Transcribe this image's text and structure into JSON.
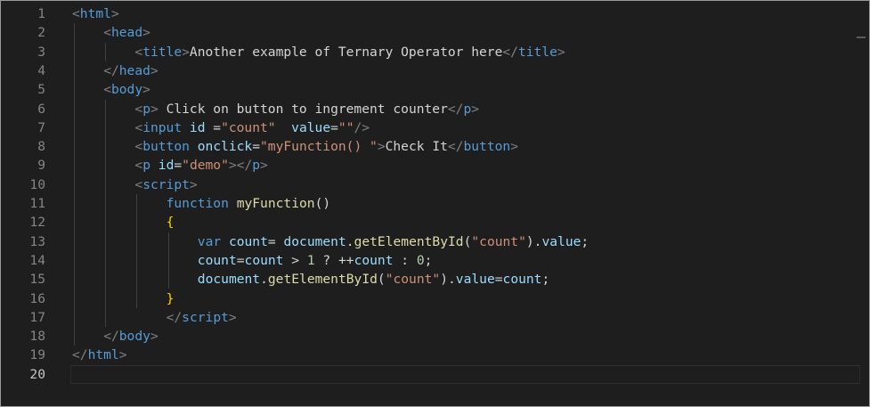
{
  "editor": {
    "line_numbers": [
      "1",
      "2",
      "3",
      "4",
      "5",
      "6",
      "7",
      "8",
      "9",
      "10",
      "11",
      "12",
      "13",
      "14",
      "15",
      "16",
      "17",
      "18",
      "19",
      "20"
    ],
    "current_line": 20,
    "colors": {
      "background": "#1e1e1e",
      "tag": "#569cd6",
      "bracket": "#808080",
      "attribute": "#9cdcfe",
      "string": "#ce9178",
      "function": "#dcdcaa",
      "brace": "#ffd700",
      "number": "#b5cea8",
      "text": "#d4d4d4"
    },
    "lines": [
      [
        [
          "<",
          "punc"
        ],
        [
          "html",
          "tag"
        ],
        [
          ">",
          "punc"
        ]
      ],
      [
        [
          "<",
          "punc"
        ],
        [
          "head",
          "tag"
        ],
        [
          ">",
          "punc"
        ]
      ],
      [
        [
          "<",
          "punc"
        ],
        [
          "title",
          "tag"
        ],
        [
          ">",
          "punc"
        ],
        [
          "Another example of Ternary Operator here",
          "text"
        ],
        [
          "</",
          "punc"
        ],
        [
          "title",
          "tag"
        ],
        [
          ">",
          "punc"
        ]
      ],
      [
        [
          "</",
          "punc"
        ],
        [
          "head",
          "tag"
        ],
        [
          ">",
          "punc"
        ]
      ],
      [
        [
          "<",
          "punc"
        ],
        [
          "body",
          "tag"
        ],
        [
          ">",
          "punc"
        ]
      ],
      [
        [
          "<",
          "punc"
        ],
        [
          "p",
          "tag"
        ],
        [
          ">",
          "punc"
        ],
        [
          " Click on button to ingrement counter",
          "text"
        ],
        [
          "</",
          "punc"
        ],
        [
          "p",
          "tag"
        ],
        [
          ">",
          "punc"
        ]
      ],
      [
        [
          "<",
          "punc"
        ],
        [
          "input",
          "tag"
        ],
        [
          " ",
          "text"
        ],
        [
          "id",
          "attr"
        ],
        [
          " =",
          "text"
        ],
        [
          "\"count\"",
          "str"
        ],
        [
          "  ",
          "text"
        ],
        [
          "value",
          "attr"
        ],
        [
          "=",
          "text"
        ],
        [
          "\"\"",
          "str"
        ],
        [
          "/>",
          "punc"
        ]
      ],
      [
        [
          "<",
          "punc"
        ],
        [
          "button",
          "tag"
        ],
        [
          " ",
          "text"
        ],
        [
          "onclick",
          "attr"
        ],
        [
          "=",
          "text"
        ],
        [
          "\"myFunction() \"",
          "str"
        ],
        [
          ">",
          "punc"
        ],
        [
          "Check It",
          "text"
        ],
        [
          "</",
          "punc"
        ],
        [
          "button",
          "tag"
        ],
        [
          ">",
          "punc"
        ]
      ],
      [
        [
          "<",
          "punc"
        ],
        [
          "p",
          "tag"
        ],
        [
          " ",
          "text"
        ],
        [
          "id",
          "attr"
        ],
        [
          "=",
          "text"
        ],
        [
          "\"demo\"",
          "str"
        ],
        [
          "></",
          "punc"
        ],
        [
          "p",
          "tag"
        ],
        [
          ">",
          "punc"
        ]
      ],
      [
        [
          "<",
          "punc"
        ],
        [
          "script",
          "tag"
        ],
        [
          ">",
          "punc"
        ]
      ],
      [
        [
          "function",
          "kw"
        ],
        [
          " ",
          "text"
        ],
        [
          "myFunction",
          "fn"
        ],
        [
          "()",
          "text"
        ]
      ],
      [
        [
          "{",
          "brace"
        ]
      ],
      [
        [
          "var",
          "kw"
        ],
        [
          " ",
          "text"
        ],
        [
          "count",
          "var"
        ],
        [
          "= ",
          "text"
        ],
        [
          "document",
          "var"
        ],
        [
          ".",
          "text"
        ],
        [
          "getElementById",
          "fn"
        ],
        [
          "(",
          "text"
        ],
        [
          "\"count\"",
          "str"
        ],
        [
          ").",
          "text"
        ],
        [
          "value",
          "var"
        ],
        [
          ";",
          "text"
        ]
      ],
      [
        [
          "count",
          "var"
        ],
        [
          "=",
          "text"
        ],
        [
          "count",
          "var"
        ],
        [
          " > ",
          "text"
        ],
        [
          "1",
          "num"
        ],
        [
          " ? ++",
          "text"
        ],
        [
          "count",
          "var"
        ],
        [
          " : ",
          "text"
        ],
        [
          "0",
          "num"
        ],
        [
          ";",
          "text"
        ]
      ],
      [
        [
          "document",
          "var"
        ],
        [
          ".",
          "text"
        ],
        [
          "getElementById",
          "fn"
        ],
        [
          "(",
          "text"
        ],
        [
          "\"count\"",
          "str"
        ],
        [
          ").",
          "text"
        ],
        [
          "value",
          "var"
        ],
        [
          "=",
          "text"
        ],
        [
          "count",
          "var"
        ],
        [
          ";",
          "text"
        ]
      ],
      [
        [
          "}",
          "brace"
        ]
      ],
      [
        [
          "</",
          "punc"
        ],
        [
          "script",
          "tag"
        ],
        [
          ">",
          "punc"
        ]
      ],
      [
        [
          "</",
          "punc"
        ],
        [
          "body",
          "tag"
        ],
        [
          ">",
          "punc"
        ]
      ],
      [
        [
          "</",
          "punc"
        ],
        [
          "html",
          "tag"
        ],
        [
          ">",
          "punc"
        ]
      ],
      []
    ]
  }
}
